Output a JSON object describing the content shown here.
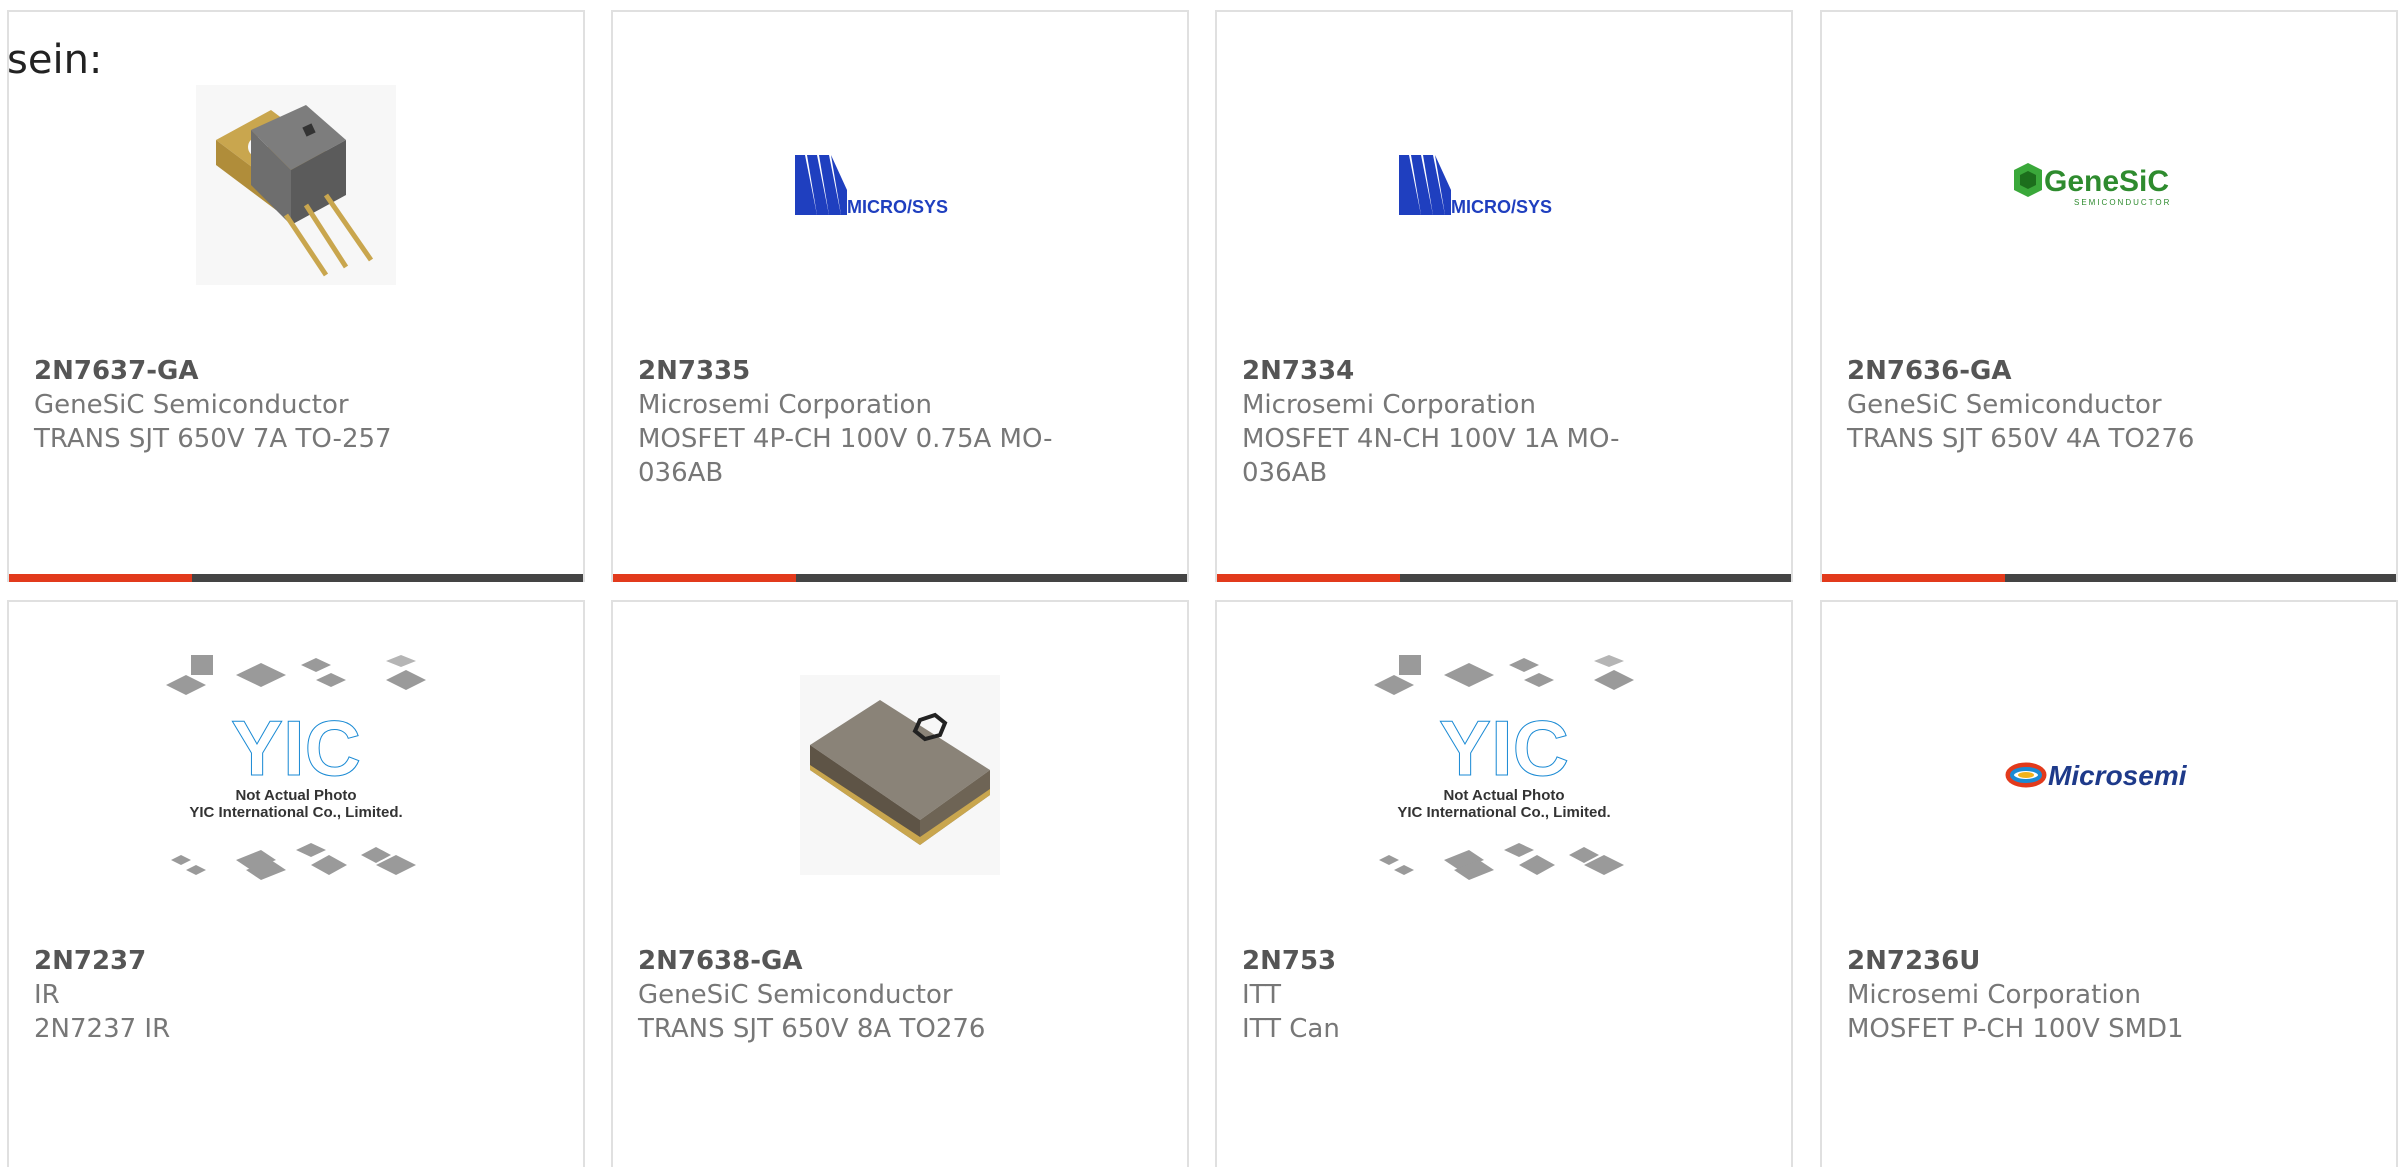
{
  "intro_text": "sein:",
  "colors": {
    "accent": "#e23a1c",
    "bar": "#444444"
  },
  "products": [
    {
      "part": "2N7637-GA",
      "maker": "GeneSiC Semiconductor",
      "desc": "TRANS SJT 650V 7A TO-257",
      "image": "to257-package-photo"
    },
    {
      "part": "2N7335",
      "maker": "Microsemi Corporation",
      "desc": "MOSFET 4P-CH 100V 0.75A MO-036AB",
      "image": "microsys-logo",
      "logo_text": "MICRO/SYS"
    },
    {
      "part": "2N7334",
      "maker": "Microsemi Corporation",
      "desc": "MOSFET 4N-CH 100V 1A MO-036AB",
      "image": "microsys-logo",
      "logo_text": "MICRO/SYS"
    },
    {
      "part": "2N7636-GA",
      "maker": "GeneSiC Semiconductor",
      "desc": "TRANS SJT 650V 4A TO276",
      "image": "genesic-logo",
      "logo_text": "GeneSiC",
      "logo_sub": "SEMICONDUCTOR"
    },
    {
      "part": "2N7237",
      "maker": "IR",
      "desc": "2N7237 IR",
      "image": "yic-placeholder",
      "note1": "Not Actual Photo",
      "note2": "YIC International Co., Limited."
    },
    {
      "part": "2N7638-GA",
      "maker": "GeneSiC Semiconductor",
      "desc": "TRANS SJT 650V 8A TO276",
      "image": "smd-package-photo"
    },
    {
      "part": "2N753",
      "maker": "ITT",
      "desc": "ITT Can",
      "image": "yic-placeholder",
      "note1": "Not Actual Photo",
      "note2": "YIC International Co., Limited."
    },
    {
      "part": "2N7236U",
      "maker": "Microsemi Corporation",
      "desc": "MOSFET P-CH 100V SMD1",
      "image": "microsemi-logo",
      "logo_text": "Microsemi"
    }
  ]
}
